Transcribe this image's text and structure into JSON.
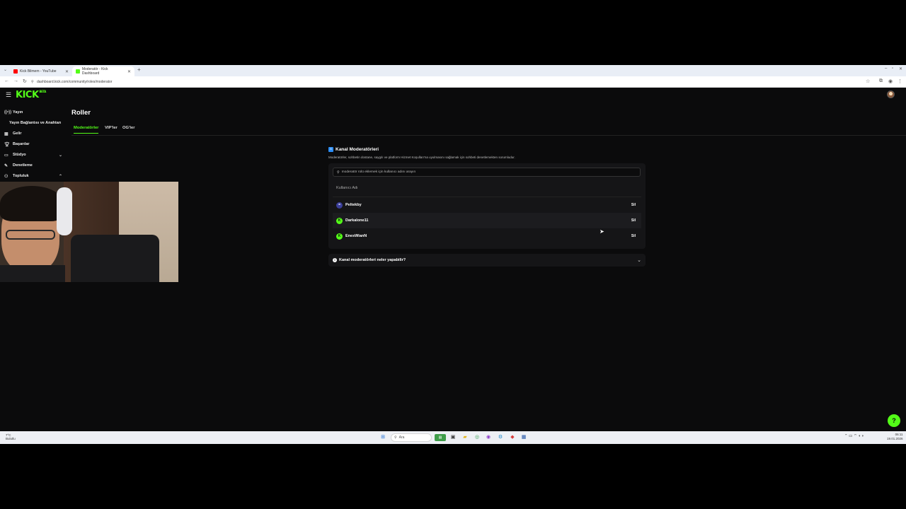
{
  "browser": {
    "tabs": [
      {
        "title": "Kick Bilmem - YouTube",
        "active": false
      },
      {
        "title": "Moderatör - Kick Dashboard",
        "active": true
      }
    ],
    "url": "dashboard.kick.com/community/roles/moderator"
  },
  "app": {
    "logo": "KICK",
    "logo_sup": "BETA",
    "sidebar": {
      "items": [
        {
          "label": "Yayın",
          "icon": "broadcast-icon"
        },
        {
          "label": "Yayın Bağlantısı ve Anahtarı",
          "icon": ""
        },
        {
          "label": "Gelir",
          "icon": "revenue-icon"
        },
        {
          "label": "Başarılar",
          "icon": "trophy-icon"
        },
        {
          "label": "Stüdyo",
          "icon": "studio-icon"
        },
        {
          "label": "Denetleme",
          "icon": "hammer-icon"
        },
        {
          "label": "Topluluk",
          "icon": "community-icon"
        }
      ]
    },
    "page_title": "Roller",
    "role_tabs": [
      "Moderatörler",
      "VIP'ler",
      "OG'ler"
    ],
    "moderators": {
      "title": "Kanal Moderatörleri",
      "description": "Moderatörler, sohbetin dostane, saygılı ve platform Hizmet Koşulları'na uyulmasını sağlamak için sohbeti denetlemekten sorumludur.",
      "search_placeholder": "moderatör rolü eklemek için kullanıcı adını arayın",
      "column_header": "Kullanıcı Adı",
      "delete_label": "Sil",
      "rows": [
        {
          "name": "Peltekby",
          "avatar_color": "#3b3f9a"
        },
        {
          "name": "Darkalone11",
          "avatar_color": "#53fc18"
        },
        {
          "name": "EnesWianN",
          "avatar_color": "#53fc18"
        }
      ],
      "faq": "Kanal moderatörleri neler yapabilir?"
    },
    "accent_color": "#53fc18"
  },
  "taskbar": {
    "weather_line1": "7°C",
    "weather_line2": "Bulutlu",
    "search_label": "Ara",
    "time": "06:11",
    "date": "19.01.2026"
  }
}
